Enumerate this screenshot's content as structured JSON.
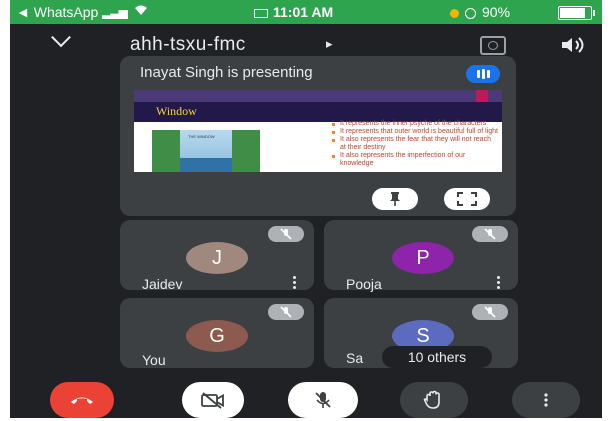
{
  "status_bar": {
    "back_to": "◄ WhatsApp",
    "time": "11:01 AM",
    "battery": "90%",
    "battery_level": 0.9
  },
  "meeting": {
    "code": "ahh-tsxu-fmc",
    "code_arrow": "▸"
  },
  "presentation": {
    "label": "Inayat Singh is presenting",
    "slide": {
      "title": "Window",
      "image_caption": "THE WINDOW",
      "bullets": [
        "It represents the inner psyche of the characters",
        "It represents that outer world is beautiful full of light",
        "It also represents the fear that they will not reach at their destiny",
        "It also represents the imperfection of our knowledge"
      ]
    }
  },
  "participants": [
    {
      "initial": "J",
      "name": "Jaidev",
      "color": "#a1887f"
    },
    {
      "initial": "P",
      "name": "Pooja",
      "color": "#8e24aa"
    },
    {
      "initial": "G",
      "name": "You",
      "color": "#8d5a4f"
    },
    {
      "initial": "S",
      "name": "Sa",
      "color": "#5c6bc0"
    }
  ],
  "others_label": "10 others",
  "icons": {
    "pin": "pin-icon",
    "fullscreen": "fullscreen-icon",
    "mic_off": "mic-off-icon",
    "end_call": "end-call-icon",
    "camera_off": "camera-off-icon",
    "raise_hand": "raise-hand-icon",
    "more": "more-vertical-icon"
  },
  "colors": {
    "status_bar": "#2ea44f",
    "background": "#202124",
    "tile": "#3c4043",
    "end_call": "#ea4335",
    "presenting_badge": "#1a73e8"
  }
}
